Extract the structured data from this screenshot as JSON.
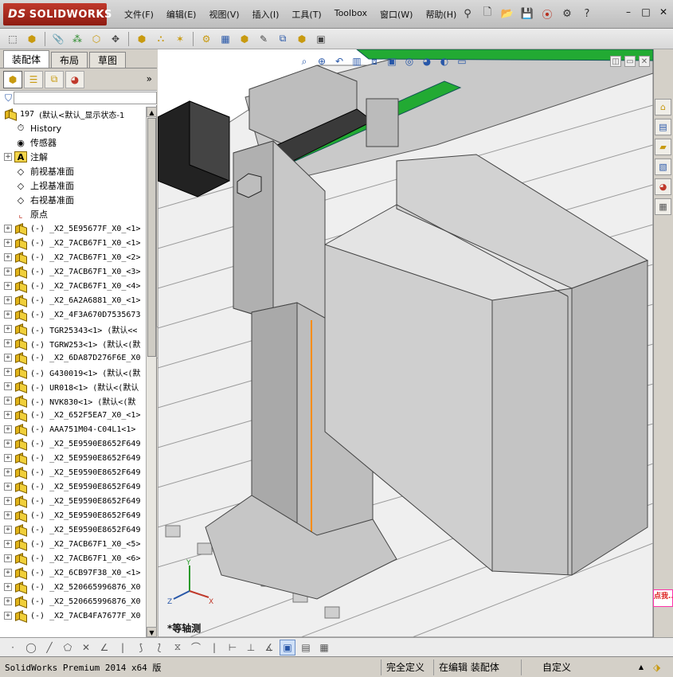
{
  "app": {
    "logo_prefix": "DS",
    "logo_text": "SOLIDWORKS"
  },
  "menu": [
    "文件(F)",
    "编辑(E)",
    "视图(V)",
    "插入(I)",
    "工具(T)",
    "Toolbox",
    "窗口(W)",
    "帮助(H)"
  ],
  "title_icons": [
    "pin-icon",
    "new-document-icon",
    "open-folder-icon",
    "save-icon",
    "traffic-light-icon",
    "help-icon"
  ],
  "window_controls": [
    "–",
    "□",
    "✕"
  ],
  "panel": {
    "tabs": [
      "装配体",
      "布局",
      "草图"
    ],
    "active_tab": "装配体",
    "icons": [
      "feature-manager-icon",
      "property-manager-icon",
      "configuration-manager-icon",
      "display-manager-icon"
    ],
    "more": "»"
  },
  "tree": {
    "root": {
      "number": "197",
      "label": "(默认<默认_显示状态-1"
    },
    "fixed_items": [
      {
        "label": "History",
        "icon": "history-icon"
      },
      {
        "label": "传感器",
        "icon": "sensor-icon"
      },
      {
        "label": "注解",
        "icon": "annotation-icon"
      },
      {
        "label": "前视基准面",
        "icon": "plane-icon"
      },
      {
        "label": "上视基准面",
        "icon": "plane-icon"
      },
      {
        "label": "右视基准面",
        "icon": "plane-icon"
      },
      {
        "label": "原点",
        "icon": "origin-icon"
      }
    ],
    "components": [
      "(-) _X2_5E95677F_X0_<1>",
      "(-) _X2_7ACB67F1_X0_<1>",
      "(-) _X2_7ACB67F1_X0_<2>",
      "(-) _X2_7ACB67F1_X0_<3>",
      "(-) _X2_7ACB67F1_X0_<4>",
      "(-) _X2_6A2A6881_X0_<1>",
      "(-) _X2_4F3A670D7535673",
      "(-) TGR25343<1> (默认<<",
      "(-) TGRW253<1> (默认<(默",
      "(-) _X2_6DA87D276F6E_X0",
      "(-) G430019<1> (默认<(默",
      "(-) UR018<1> (默认<(默认",
      "(-) NVK830<1> (默认<(默",
      "(-) _X2_652F5EA7_X0_<1>",
      "(-) AAA751M04-C04L1<1>",
      "(-) _X2_5E9590E8652F649",
      "(-) _X2_5E9590E8652F649",
      "(-) _X2_5E9590E8652F649",
      "(-) _X2_5E9590E8652F649",
      "(-) _X2_5E9590E8652F649",
      "(-) _X2_5E9590E8652F649",
      "(-) _X2_5E9590E8652F649",
      "(-) _X2_7ACB67F1_X0_<5>",
      "(-) _X2_7ACB67F1_X0_<6>",
      "(-) _X2_6CB97F38_X0_<1>",
      "(-) _X2_520665996876_X0",
      "(-) _X2_520665996876_X0",
      "(-) _X2_7ACB4FA7677F_X0"
    ]
  },
  "viewport": {
    "view_label": "*等轴测",
    "triad_axes": [
      "X",
      "Y",
      "Z"
    ]
  },
  "taskpane": {
    "buttons": [
      "home-icon",
      "resources-icon",
      "design-library-icon",
      "file-explorer-icon",
      "appearances-icon",
      "custom-properties-icon"
    ],
    "tip_text": "点我..."
  },
  "statusbar": {
    "product": "SolidWorks Premium 2014 x64 版",
    "definition": "完全定义",
    "editing": "在编辑 装配体",
    "units": "自定义",
    "units_arrow": "▲"
  }
}
